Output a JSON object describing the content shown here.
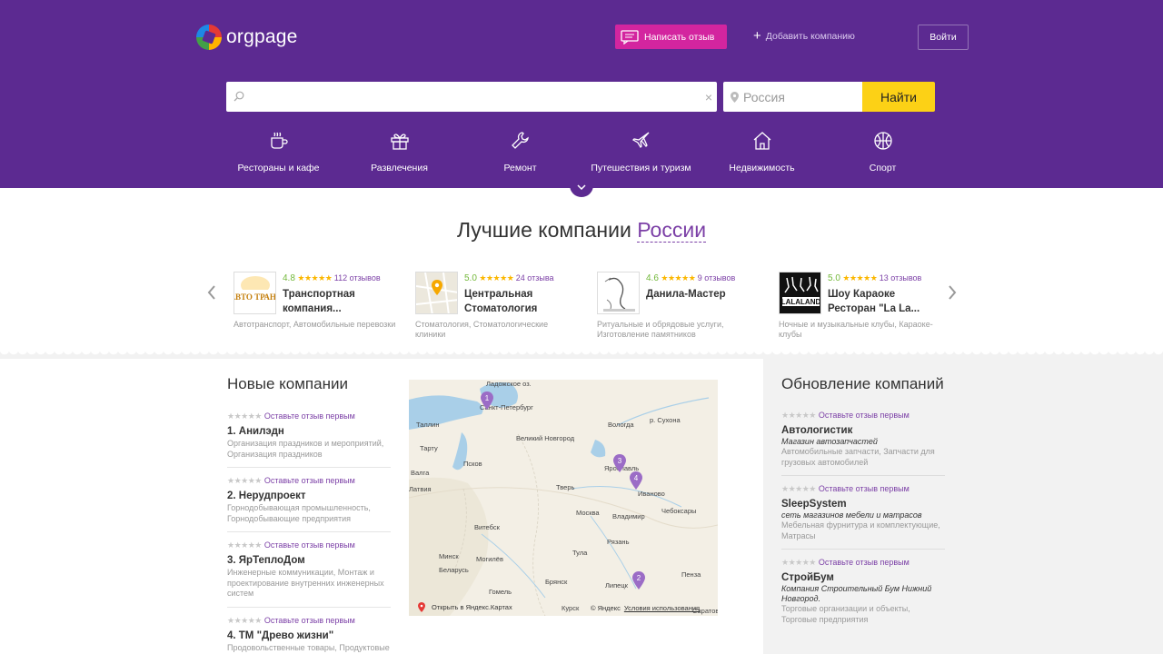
{
  "header": {
    "logo_text": "orgpage",
    "write_review": "Написать отзыв",
    "add_company": "Добавить компанию",
    "login": "Войти",
    "search_placeholder": "",
    "region_placeholder": "Россия",
    "find": "Найти",
    "categories": [
      {
        "label": "Рестораны и кафе",
        "icon": "cup-icon"
      },
      {
        "label": "Развлечения",
        "icon": "gift-icon"
      },
      {
        "label": "Ремонт",
        "icon": "wrench-icon"
      },
      {
        "label": "Путешествия и туризм",
        "icon": "plane-icon"
      },
      {
        "label": "Недвижимость",
        "icon": "house-icon"
      },
      {
        "label": "Спорт",
        "icon": "ball-icon"
      }
    ]
  },
  "best": {
    "title_prefix": "Лучшие компании",
    "region": "России",
    "companies": [
      {
        "rating": "4.8",
        "stars": "★★★★★",
        "reviews": "112 отзывов",
        "name": "Транспортная компания...",
        "category": "Автотранспорт, Автомобильные перевозки",
        "thumb": "АВТО ТРАНС"
      },
      {
        "rating": "5.0",
        "stars": "★★★★★",
        "reviews": "24 отзыва",
        "name": "Центральная Стоматология",
        "category": "Стоматология, Стоматологические клиники",
        "thumb": ""
      },
      {
        "rating": "4.6",
        "stars": "★★★★★",
        "reviews": "9 отзывов",
        "name": "Данила-Мастер",
        "category": "Ритуальные и обрядовые услуги, Изготовление памятников",
        "thumb": ""
      },
      {
        "rating": "5.0",
        "stars": "★★★★★",
        "reviews": "13 отзывов",
        "name": "Шоу Караоке Ресторан \"La La...",
        "category": "Ночные и музыкальные клубы, Караоке-клубы",
        "thumb": "LALALAND"
      }
    ]
  },
  "new_companies": {
    "title": "Новые компании",
    "review_prompt": "Оставьте отзыв первым",
    "stars": "★★★★★",
    "items": [
      {
        "name": "1. Анилэдн",
        "desc": "Организация праздников и мероприятий, Организация праздников"
      },
      {
        "name": "2. Нерудпроект",
        "desc": "Горнодобывающая промышленность, Горнодобывающие предприятия"
      },
      {
        "name": "3. ЯрТеплоДом",
        "desc": "Инженерные коммуникации, Монтаж и проектирование внутренних инженерных систем"
      },
      {
        "name": "4. ТМ \"Древо жизни\"",
        "desc": "Продовольственные товары, Продуктовые"
      }
    ]
  },
  "updates": {
    "title": "Обновление компаний",
    "review_prompt": "Оставьте отзыв первым",
    "stars": "★★★★★",
    "items": [
      {
        "name": "Автологистик",
        "sub": "Магазин автозапчастей",
        "desc": "Автомобильные запчасти, Запчасти для грузовых автомобилей"
      },
      {
        "name": "SleepSystem",
        "sub": "сеть магазинов мебели и матрасов",
        "desc": "Мебельная фурнитура и комплектующие, Матрасы"
      },
      {
        "name": "СтройБум",
        "sub": "Компания Строительный Бум Нижний Новгород.",
        "desc": "Торговые организации и объекты, Торговые предприятия"
      }
    ]
  },
  "map": {
    "open_link": "Открыть в Яндекс.Картах",
    "copyright": "© Яндекс",
    "terms": "Условия использования",
    "labels": [
      "Ладожское оз.",
      "Санкт-Петербург",
      "Таллин",
      "Тарту",
      "Валга",
      "Латвия",
      "Великий Новгород",
      "Псков",
      "Вологда",
      "р. Сухона",
      "Ярославль",
      "Тверь",
      "Иваново",
      "Москва",
      "Владимир",
      "Чебоксары",
      "Витебск",
      "Минск",
      "Могилёв",
      "Беларусь",
      "Тула",
      "Рязань",
      "Гомель",
      "Брянск",
      "Липецк",
      "Пенза",
      "Курск",
      "Саратов"
    ],
    "markers": [
      "1",
      "3",
      "4",
      "2"
    ]
  },
  "colors": {
    "brand": "#5c2a91",
    "accent": "#d3259f",
    "find": "#fcd116",
    "rating": "#73b83a",
    "star": "#fbb700"
  }
}
